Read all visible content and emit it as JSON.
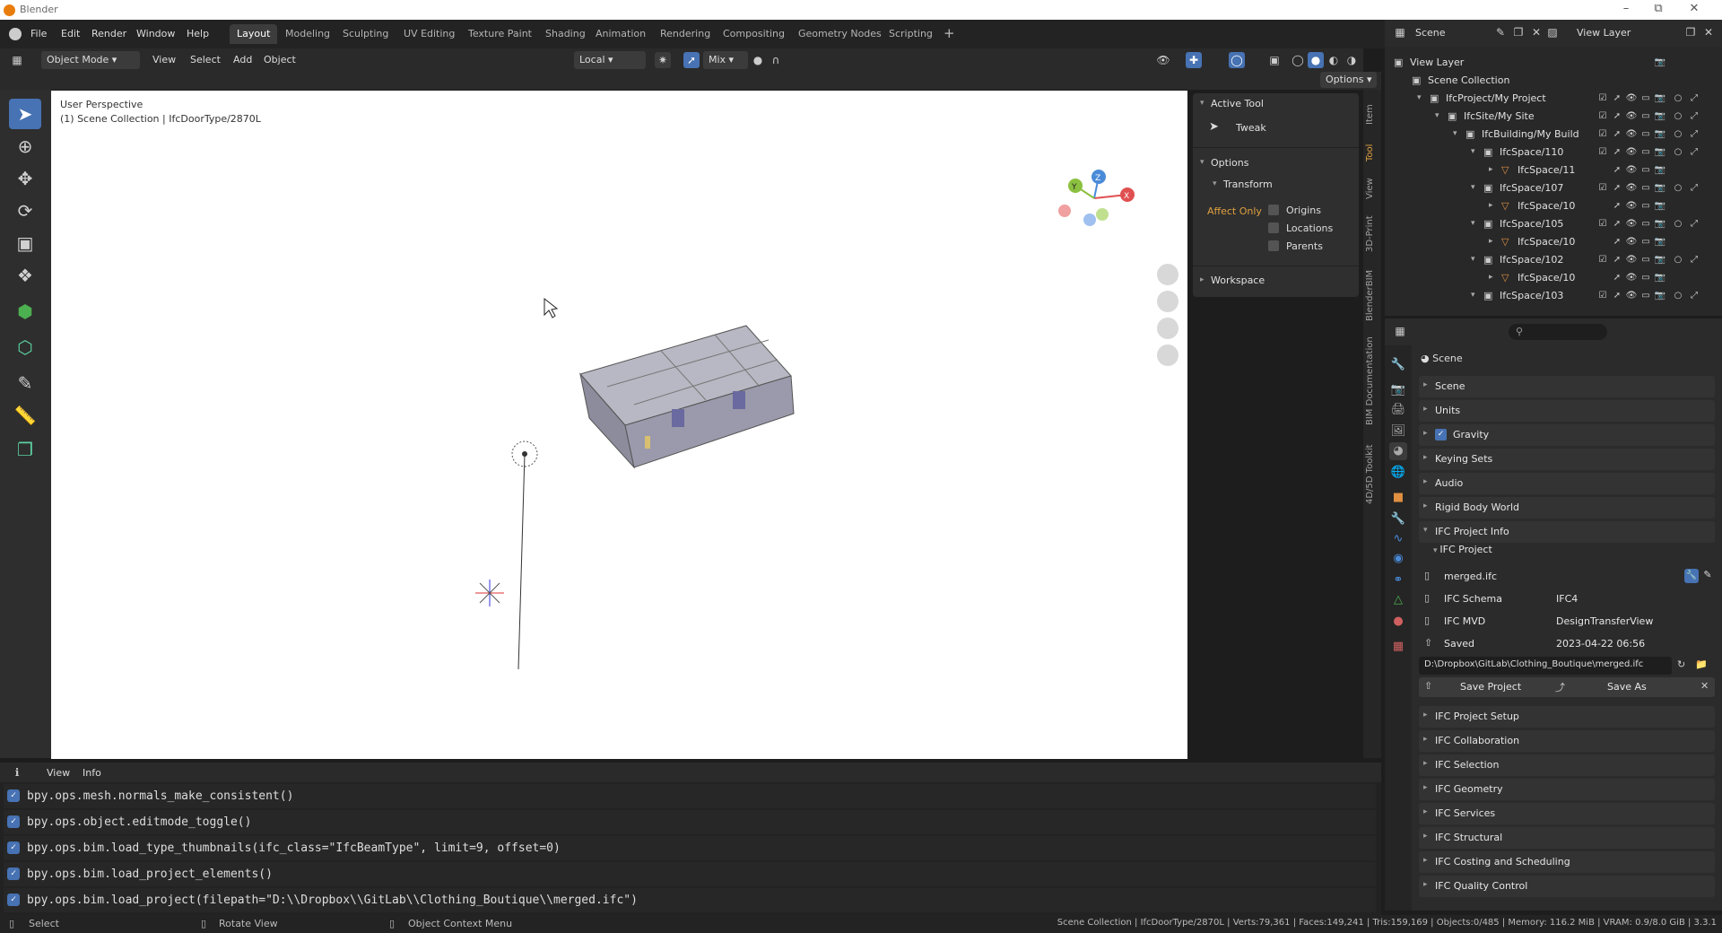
{
  "window": {
    "title": "Blender"
  },
  "menus": [
    "File",
    "Edit",
    "Render",
    "Window",
    "Help"
  ],
  "workspaces": [
    "Layout",
    "Modeling",
    "Sculpting",
    "UV Editing",
    "Texture Paint",
    "Shading",
    "Animation",
    "Rendering",
    "Compositing",
    "Geometry Nodes",
    "Scripting"
  ],
  "scene_selector": "Scene",
  "view_layer_selector": "View Layer",
  "header3d": {
    "mode": "Object Mode",
    "view": "View",
    "select": "Select",
    "add": "Add",
    "object": "Object",
    "orientation": "Local",
    "snap": "Mix",
    "options": "Options"
  },
  "viewport": {
    "line1": "User Perspective",
    "line2": "(1) Scene Collection | IfcDoorType/2870L",
    "gizmo_x": "X",
    "gizmo_y": "Y",
    "gizmo_z": "Z"
  },
  "npanel": {
    "active_tool_header": "Active Tool",
    "tool_name": "Tweak",
    "options_header": "Options",
    "transform": "Transform",
    "affect_only": "Affect Only",
    "origins": "Origins",
    "locations": "Locations",
    "parents": "Parents",
    "workspace": "Workspace"
  },
  "ntabs": [
    "Item",
    "Tool",
    "View",
    "3D-Print",
    "BlenderBIM",
    "BIM Documentation",
    "4D/5D Toolkit"
  ],
  "outliner": {
    "rows": [
      {
        "label": "View Layer",
        "indent": 0
      },
      {
        "label": "Scene Collection",
        "indent": 1
      },
      {
        "label": "IfcProject/My Project",
        "indent": 2
      },
      {
        "label": "IfcSite/My Site",
        "indent": 3
      },
      {
        "label": "IfcBuilding/My Build",
        "indent": 4
      },
      {
        "label": "IfcSpace/110",
        "indent": 5
      },
      {
        "label": "IfcSpace/11",
        "indent": 6
      },
      {
        "label": "IfcSpace/107",
        "indent": 5
      },
      {
        "label": "IfcSpace/10",
        "indent": 6
      },
      {
        "label": "IfcSpace/105",
        "indent": 5
      },
      {
        "label": "IfcSpace/10",
        "indent": 6
      },
      {
        "label": "IfcSpace/102",
        "indent": 5
      },
      {
        "label": "IfcSpace/10",
        "indent": 6
      },
      {
        "label": "IfcSpace/103",
        "indent": 5
      }
    ]
  },
  "properties": {
    "context": "Scene",
    "panels": [
      "Scene",
      "Units",
      "Gravity",
      "Keying Sets",
      "Audio",
      "Rigid Body World"
    ],
    "ifc_project_info": "IFC Project Info",
    "ifc_project": "IFC Project",
    "file": "merged.ifc",
    "schema_label": "IFC Schema",
    "schema_value": "IFC4",
    "mvd_label": "IFC MVD",
    "mvd_value": "DesignTransferView",
    "saved_label": "Saved",
    "saved_value": "2023-04-22 06:56",
    "path": "D:\\Dropbox\\GitLab\\Clothing_Boutique\\merged.ifc",
    "save_project": "Save Project",
    "save_as": "Save As",
    "more_panels": [
      "IFC Project Setup",
      "IFC Collaboration",
      "IFC Selection",
      "IFC Geometry",
      "IFC Services",
      "IFC Structural",
      "IFC Costing and Scheduling",
      "IFC Quality Control"
    ]
  },
  "console": {
    "view": "View",
    "info": "Info",
    "lines": [
      "bpy.ops.mesh.normals_make_consistent()",
      "bpy.ops.object.editmode_toggle()",
      "bpy.ops.bim.load_type_thumbnails(ifc_class=\"IfcBeamType\", limit=9, offset=0)",
      "bpy.ops.bim.load_project_elements()",
      "bpy.ops.bim.load_project(filepath=\"D:\\\\Dropbox\\\\GitLab\\\\Clothing_Boutique\\\\merged.ifc\")"
    ]
  },
  "status": {
    "select": "Select",
    "rotate": "Rotate View",
    "context_menu": "Object Context Menu",
    "info": "Scene Collection | IfcDoorType/2870L | Verts:79,361 | Faces:149,241 | Tris:159,169 | Objects:0/485 | Memory: 116.2 MiB | VRAM: 0.9/8.0 GiB | 3.3.1"
  }
}
